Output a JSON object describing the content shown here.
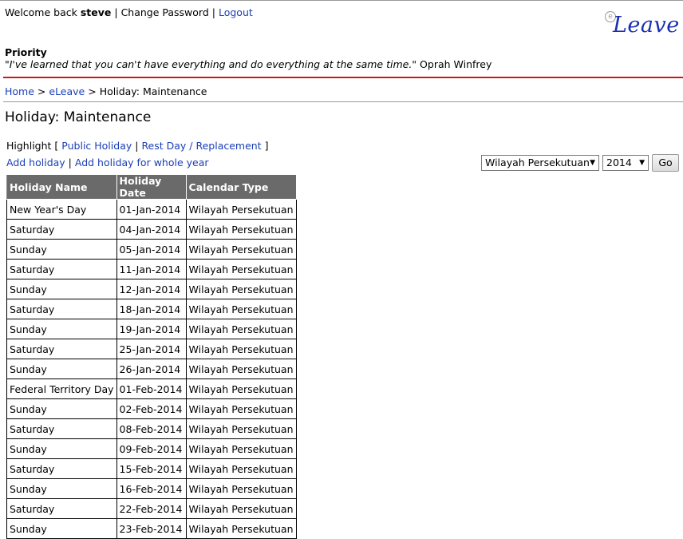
{
  "header": {
    "welcome_prefix": "Welcome back",
    "username": "steve",
    "sep1": "|",
    "change_password": "Change Password",
    "sep2": "|",
    "logout": "Logout",
    "logo_text": "Leave",
    "logo_icon_glyph": "e"
  },
  "priority": {
    "heading": "Priority",
    "quote": "\"I've learned that you can't have everything and do everything at the same time.\"",
    "author": "Oprah Winfrey"
  },
  "breadcrumb": {
    "home": "Home",
    "sep": ">",
    "eleave": "eLeave",
    "current": "Holiday: Maintenance"
  },
  "page_title": "Holiday: Maintenance",
  "highlight": {
    "label": "Highlight",
    "open": "[",
    "public_holiday": "Public Holiday",
    "sep": "|",
    "rest_day": "Rest Day / Replacement",
    "close": "]"
  },
  "actions": {
    "add_holiday": "Add holiday",
    "sep": "|",
    "add_whole_year": "Add holiday for whole year"
  },
  "filter": {
    "calendar_selected": "Wilayah Persekutuan",
    "year_selected": "2014",
    "go_label": "Go"
  },
  "table": {
    "headers": [
      "Holiday Name",
      "Holiday Date",
      "Calendar Type"
    ],
    "rows": [
      [
        "New Year's Day",
        "01-Jan-2014",
        "Wilayah Persekutuan"
      ],
      [
        "Saturday",
        "04-Jan-2014",
        "Wilayah Persekutuan"
      ],
      [
        "Sunday",
        "05-Jan-2014",
        "Wilayah Persekutuan"
      ],
      [
        "Saturday",
        "11-Jan-2014",
        "Wilayah Persekutuan"
      ],
      [
        "Sunday",
        "12-Jan-2014",
        "Wilayah Persekutuan"
      ],
      [
        "Saturday",
        "18-Jan-2014",
        "Wilayah Persekutuan"
      ],
      [
        "Sunday",
        "19-Jan-2014",
        "Wilayah Persekutuan"
      ],
      [
        "Saturday",
        "25-Jan-2014",
        "Wilayah Persekutuan"
      ],
      [
        "Sunday",
        "26-Jan-2014",
        "Wilayah Persekutuan"
      ],
      [
        "Federal Territory Day",
        "01-Feb-2014",
        "Wilayah Persekutuan"
      ],
      [
        "Sunday",
        "02-Feb-2014",
        "Wilayah Persekutuan"
      ],
      [
        "Saturday",
        "08-Feb-2014",
        "Wilayah Persekutuan"
      ],
      [
        "Sunday",
        "09-Feb-2014",
        "Wilayah Persekutuan"
      ],
      [
        "Saturday",
        "15-Feb-2014",
        "Wilayah Persekutuan"
      ],
      [
        "Sunday",
        "16-Feb-2014",
        "Wilayah Persekutuan"
      ],
      [
        "Saturday",
        "22-Feb-2014",
        "Wilayah Persekutuan"
      ],
      [
        "Sunday",
        "23-Feb-2014",
        "Wilayah Persekutuan"
      ]
    ]
  },
  "colors": {
    "link": "#1a3fb6",
    "divider_red": "#c81c1c",
    "table_header_bg": "#6a6a6a",
    "logo": "#1a2fb0"
  }
}
